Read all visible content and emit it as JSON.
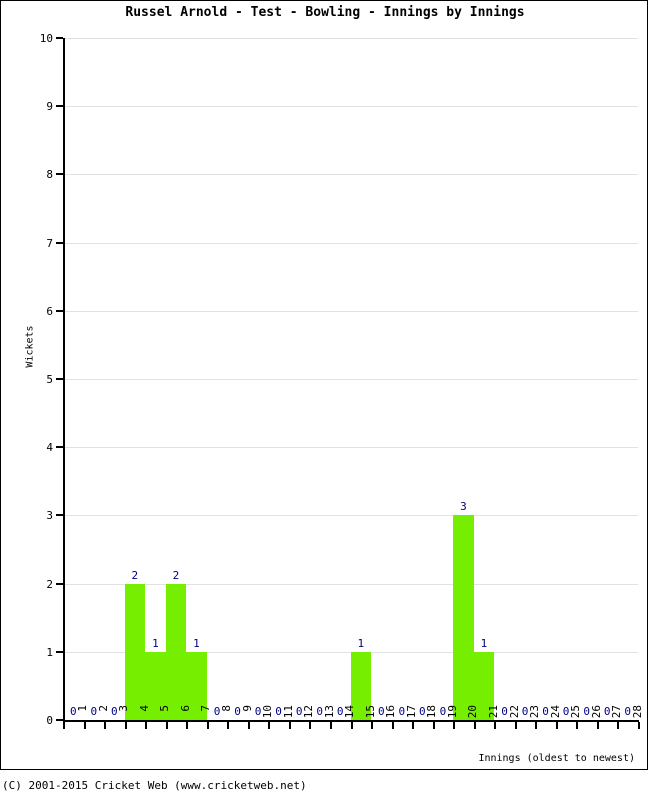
{
  "chart_data": {
    "type": "bar",
    "title": "Russel Arnold - Test - Bowling - Innings by Innings",
    "xlabel": "Innings (oldest to newest)",
    "ylabel": "Wickets",
    "ylim": [
      0,
      10
    ],
    "ytick_labels": [
      "0",
      "1",
      "2",
      "3",
      "4",
      "5",
      "6",
      "7",
      "8",
      "9",
      "10"
    ],
    "yticks": [
      0,
      1,
      2,
      3,
      4,
      5,
      6,
      7,
      8,
      9,
      10
    ],
    "grid": true,
    "legend": "none",
    "bar_color": "#76EE00",
    "label_color": "#000080",
    "categories": [
      "1",
      "2",
      "3",
      "4",
      "5",
      "6",
      "7",
      "8",
      "9",
      "10",
      "11",
      "12",
      "13",
      "14",
      "15",
      "16",
      "17",
      "18",
      "19",
      "20",
      "21",
      "22",
      "23",
      "24",
      "25",
      "26",
      "27",
      "28"
    ],
    "values": [
      0,
      0,
      0,
      2,
      1,
      2,
      1,
      0,
      0,
      0,
      0,
      0,
      0,
      0,
      1,
      0,
      0,
      0,
      0,
      3,
      1,
      0,
      0,
      0,
      0,
      0,
      0,
      0
    ],
    "point_labels": [
      "0",
      "0",
      "0",
      "2",
      "1",
      "2",
      "1",
      "0",
      "0",
      "0",
      "0",
      "0",
      "0",
      "0",
      "1",
      "0",
      "0",
      "0",
      "0",
      "3",
      "1",
      "0",
      "0",
      "0",
      "0",
      "0",
      "0",
      "0"
    ]
  },
  "footer": {
    "copyright": "(C) 2001-2015 Cricket Web (www.cricketweb.net)"
  }
}
